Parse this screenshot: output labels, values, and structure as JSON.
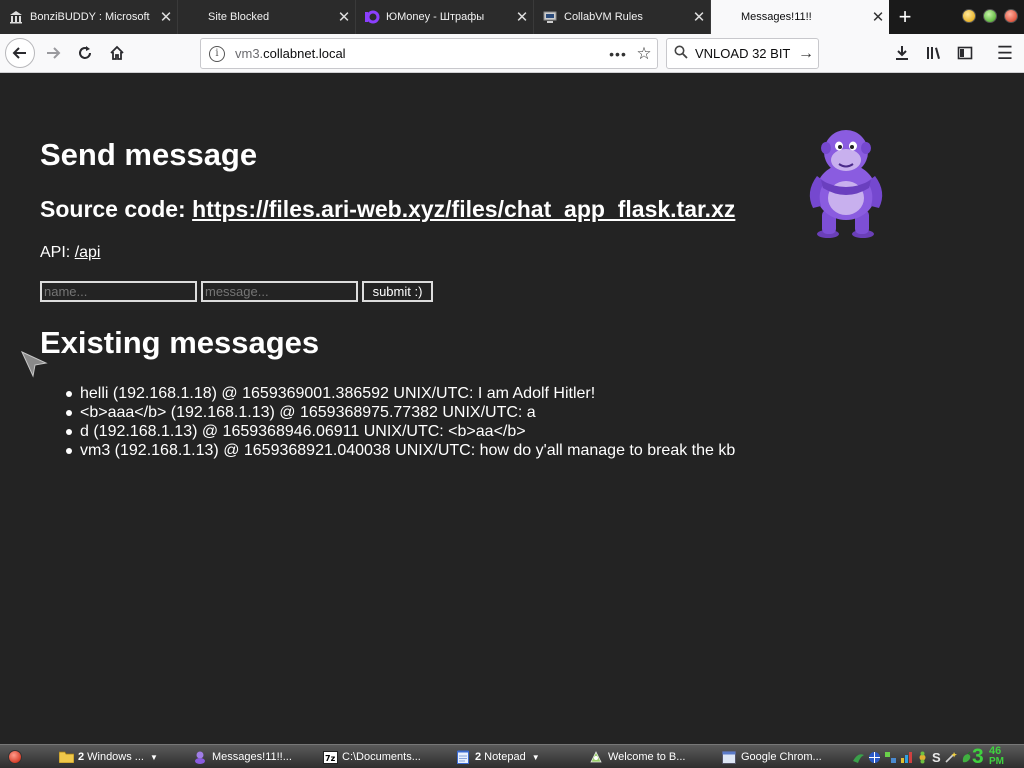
{
  "browser": {
    "tabs": [
      {
        "title": "BonziBUDDY : Microsoft",
        "icon": "building-icon",
        "active": false
      },
      {
        "title": "Site Blocked",
        "icon": "none",
        "active": false
      },
      {
        "title": "ЮMoney - Штрафы",
        "icon": "yoomoney-icon",
        "active": false
      },
      {
        "title": "CollabVM Rules",
        "icon": "collabvm-icon",
        "active": false
      },
      {
        "title": "Messages!11!!",
        "icon": "none",
        "active": true
      }
    ],
    "url_prefix": "vm3.",
    "url_host": "collabnet.local",
    "search_value": "VNLOAD 32 BIT"
  },
  "page": {
    "heading": "Send message",
    "source_label": "Source code: ",
    "source_link": "https://files.ari-web.xyz/files/chat_app_flask.tar.xz",
    "api_label": "API: ",
    "api_link": "/api",
    "name_placeholder": "name...",
    "message_placeholder": "message...",
    "submit_label": "submit :)",
    "messages_heading": "Existing messages",
    "messages": [
      "helli (192.168.1.18) @ 1659369001.386592 UNIX/UTC: I am Adolf Hitler!",
      "<b>aaa</b> (192.168.1.13) @ 1659368975.77382 UNIX/UTC: a",
      "d (192.168.1.13) @ 1659368946.06911 UNIX/UTC: <b>aa</b>",
      "vm3 (192.168.1.13) @ 1659368921.040038 UNIX/UTC: how do y'all manage to break the kb"
    ]
  },
  "taskbar": {
    "tasks": [
      {
        "count": "2",
        "label": "Windows ...",
        "icon": "folder-icon",
        "dropdown": true
      },
      {
        "count": "",
        "label": "Messages!11!!...",
        "icon": "bonzi-task-icon",
        "dropdown": false
      },
      {
        "count": "",
        "label": "C:\\Documents...",
        "icon": "7zip-icon",
        "dropdown": false
      },
      {
        "count": "2",
        "label": "Notepad",
        "icon": "notepad-icon",
        "dropdown": true
      },
      {
        "count": "",
        "label": "Welcome to B...",
        "icon": "bonzi-setup-icon",
        "dropdown": false
      },
      {
        "count": "",
        "label": "Google Chrom...",
        "icon": "chrome-window-icon",
        "dropdown": false
      }
    ],
    "clock_hour": "3",
    "clock_minute": "46",
    "clock_ampm": "PM"
  },
  "colors": {
    "page_bg": "#232323",
    "text": "#ffffff",
    "clock": "#3fd23f"
  }
}
